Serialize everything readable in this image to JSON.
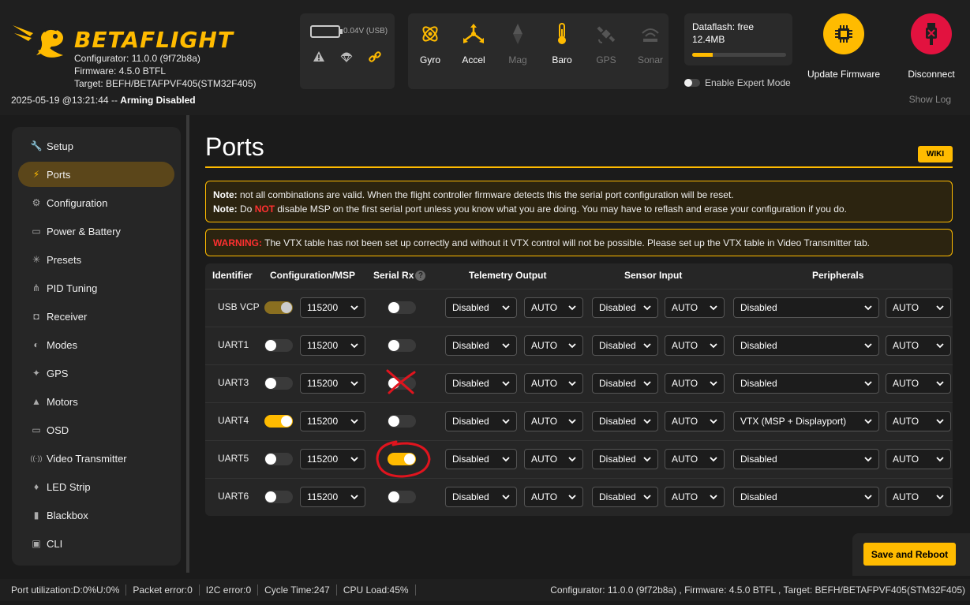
{
  "header": {
    "brand": "BETAFLIGHT",
    "configurator": "Configurator: 11.0.0 (9f72b8a)",
    "firmware": "Firmware: 4.5.0 BTFL",
    "target": "Target: BEFH/BETAFPVF405(STM32F405)",
    "date": "2025-05-19 @13:21:44 -- ",
    "arming": "Arming Disabled",
    "battery": "0.04V (USB)",
    "sensors": [
      {
        "label": "Gyro",
        "active": true,
        "icon": "gyro-icon"
      },
      {
        "label": "Accel",
        "active": true,
        "icon": "accel-icon"
      },
      {
        "label": "Mag",
        "active": false,
        "icon": "mag-icon"
      },
      {
        "label": "Baro",
        "active": true,
        "icon": "baro-icon"
      },
      {
        "label": "GPS",
        "active": false,
        "icon": "gps-icon"
      },
      {
        "label": "Sonar",
        "active": false,
        "icon": "sonar-icon"
      }
    ],
    "dataflash_label": "Dataflash: free",
    "dataflash_size": "12.4MB",
    "dataflash_used_fraction": 0.22,
    "expert_mode": "Enable Expert Mode",
    "update_firmware": "Update Firmware",
    "disconnect": "Disconnect",
    "show_log": "Show Log"
  },
  "sidebar": {
    "items": [
      {
        "label": "Setup",
        "icon": "wrench-icon",
        "active": false
      },
      {
        "label": "Ports",
        "icon": "plug-icon",
        "active": true
      },
      {
        "label": "Configuration",
        "icon": "gear-icon",
        "active": false
      },
      {
        "label": "Power & Battery",
        "icon": "battery-icon",
        "active": false
      },
      {
        "label": "Presets",
        "icon": "wand-icon",
        "active": false
      },
      {
        "label": "PID Tuning",
        "icon": "sliders-icon",
        "active": false
      },
      {
        "label": "Receiver",
        "icon": "receiver-icon",
        "active": false
      },
      {
        "label": "Modes",
        "icon": "toggle-icon",
        "active": false
      },
      {
        "label": "GPS",
        "icon": "satellite-icon",
        "active": false
      },
      {
        "label": "Motors",
        "icon": "motor-icon",
        "active": false
      },
      {
        "label": "OSD",
        "icon": "osd-icon",
        "active": false
      },
      {
        "label": "Video Transmitter",
        "icon": "antenna-icon",
        "active": false
      },
      {
        "label": "LED Strip",
        "icon": "led-icon",
        "active": false
      },
      {
        "label": "Blackbox",
        "icon": "blackbox-icon",
        "active": false
      },
      {
        "label": "CLI",
        "icon": "terminal-icon",
        "active": false
      }
    ]
  },
  "main": {
    "title": "Ports",
    "wiki": "WIKI",
    "note1_label": "Note:",
    "note1_text": " not all combinations are valid. When the flight controller firmware detects this the serial port configuration will be reset.",
    "note2_label": "Note:",
    "note2_pre": " Do ",
    "note2_not": "NOT",
    "note2_post": " disable MSP on the first serial port unless you know what you are doing. You may have to reflash and erase your configuration if you do.",
    "warning_label": "WARNING:",
    "warning_text": " The VTX table has not been set up correctly and without it VTX control will not be possible. Please set up the VTX table in Video Transmitter tab.",
    "save_reboot": "Save and Reboot"
  },
  "table": {
    "headers": {
      "identifier": "Identifier",
      "config_msp": "Configuration/MSP",
      "serial_rx": "Serial Rx",
      "telemetry": "Telemetry Output",
      "sensor": "Sensor Input",
      "peripherals": "Peripherals"
    },
    "rows": [
      {
        "id": "USB VCP",
        "msp": "on-dim",
        "baud": "115200",
        "serial_rx": false,
        "telemetry": "Disabled",
        "telemetry_baud": "AUTO",
        "sensor": "Disabled",
        "sensor_baud": "AUTO",
        "peripheral": "Disabled",
        "peripheral_baud": "AUTO"
      },
      {
        "id": "UART1",
        "msp": "off",
        "baud": "115200",
        "serial_rx": false,
        "telemetry": "Disabled",
        "telemetry_baud": "AUTO",
        "sensor": "Disabled",
        "sensor_baud": "AUTO",
        "peripheral": "Disabled",
        "peripheral_baud": "AUTO"
      },
      {
        "id": "UART3",
        "msp": "off",
        "baud": "115200",
        "serial_rx": false,
        "telemetry": "Disabled",
        "telemetry_baud": "AUTO",
        "sensor": "Disabled",
        "sensor_baud": "AUTO",
        "peripheral": "Disabled",
        "peripheral_baud": "AUTO"
      },
      {
        "id": "UART4",
        "msp": "on",
        "baud": "115200",
        "serial_rx": false,
        "telemetry": "Disabled",
        "telemetry_baud": "AUTO",
        "sensor": "Disabled",
        "sensor_baud": "AUTO",
        "peripheral": "VTX (MSP + Displayport)",
        "peripheral_baud": "AUTO"
      },
      {
        "id": "UART5",
        "msp": "off",
        "baud": "115200",
        "serial_rx": true,
        "telemetry": "Disabled",
        "telemetry_baud": "AUTO",
        "sensor": "Disabled",
        "sensor_baud": "AUTO",
        "peripheral": "Disabled",
        "peripheral_baud": "AUTO"
      },
      {
        "id": "UART6",
        "msp": "off",
        "baud": "115200",
        "serial_rx": false,
        "telemetry": "Disabled",
        "telemetry_baud": "AUTO",
        "sensor": "Disabled",
        "sensor_baud": "AUTO",
        "peripheral": "Disabled",
        "peripheral_baud": "AUTO"
      }
    ]
  },
  "footer": {
    "port_util": "Port utilization:D:0%U:0%",
    "packet_error": "Packet error:0",
    "i2c_error": "I2C error:0",
    "cycle_time": "Cycle Time:247",
    "cpu_load": "CPU Load:45%",
    "right": "Configurator: 11.0.0 (9f72b8a) , Firmware: 4.5.0 BTFL , Target: BEFH/BETAFPVF405(STM32F405)"
  },
  "colors": {
    "accent": "#ffbb00",
    "disconnect": "#e2123f",
    "annotation": "#e0141e"
  }
}
